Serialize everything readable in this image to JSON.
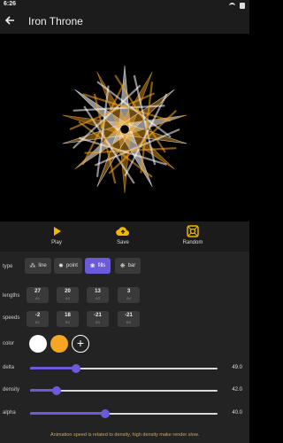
{
  "status": {
    "time": "6:26"
  },
  "appbar": {
    "title": "Iron Throne",
    "back_icon": "arrow-left-icon"
  },
  "canvas": {
    "colors": [
      "#ffffff",
      "#f5a623"
    ],
    "background": "#000000"
  },
  "actions": [
    {
      "label": "Play",
      "icon": "play-icon"
    },
    {
      "label": "Save",
      "icon": "cloud-upload-icon"
    },
    {
      "label": "Random",
      "icon": "shuffle-icon"
    }
  ],
  "type": {
    "label": "type",
    "options": [
      {
        "label": "line",
        "glyph": "⁂",
        "active": false
      },
      {
        "label": "point",
        "glyph": "✸",
        "active": false
      },
      {
        "label": "fills",
        "glyph": "❀",
        "active": true
      },
      {
        "label": "bar",
        "glyph": "❋",
        "active": false
      }
    ]
  },
  "lengths": {
    "label": "lengths",
    "items": [
      {
        "value": "27",
        "sub": "A1"
      },
      {
        "value": "20",
        "sub": "A2"
      },
      {
        "value": "13",
        "sub": "A3"
      },
      {
        "value": "3",
        "sub": "A4"
      }
    ]
  },
  "speeds": {
    "label": "speeds",
    "items": [
      {
        "value": "-2",
        "sub": "B1"
      },
      {
        "value": "18",
        "sub": "B2"
      },
      {
        "value": "-21",
        "sub": "B3"
      },
      {
        "value": "-21",
        "sub": "B4"
      }
    ]
  },
  "color": {
    "label": "color",
    "swatches": [
      "#ffffff",
      "#f5a623"
    ],
    "add_label": "+"
  },
  "sliders": [
    {
      "name": "delta",
      "label": "delta",
      "value": "49.0",
      "fraction": 0.245
    },
    {
      "name": "density",
      "label": "density",
      "value": "42.0",
      "fraction": 0.14
    },
    {
      "name": "alpha",
      "label": "alpha",
      "value": "40.0",
      "fraction": 0.4
    }
  ],
  "accent": "#6b5bd8",
  "footnote": "Animation speed is related to density, high density make render slow."
}
